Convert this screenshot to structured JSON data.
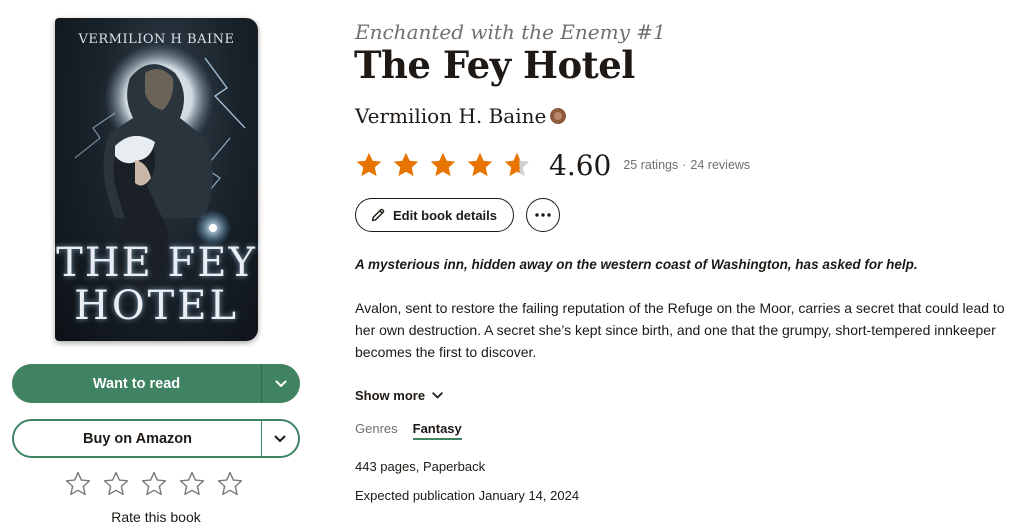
{
  "book": {
    "series": "Enchanted with the Enemy #1",
    "title": "The Fey Hotel",
    "author": "Vermilion H. Baine",
    "cover": {
      "author_text": "VERMILION H BAINE",
      "title_line1": "THE FEY",
      "title_line2": "HOTEL"
    }
  },
  "rating": {
    "average": "4.60",
    "stars_value": 4.6,
    "ratings_count": "25 ratings",
    "separator": "·",
    "reviews_count": "24 reviews",
    "star_color": "#e87400",
    "star_empty_color": "#cfcfcf"
  },
  "actions": {
    "edit_label": "Edit book details",
    "more_icon": "ellipsis-icon"
  },
  "shelf": {
    "want_to_read_label": "Want to read",
    "buy_label": "Buy on Amazon",
    "rate_label": "Rate this book",
    "accent_color": "#3f8363"
  },
  "description": {
    "tagline": "A mysterious inn, hidden away on the western coast of Washington, has asked for help.",
    "body": "Avalon, sent to restore the failing reputation of the Refuge on the Moor, carries a secret that could lead to her own destruction. A secret she’s kept since birth, and one that the grumpy, short-tempered innkeeper becomes the first to discover.",
    "show_more_label": "Show more"
  },
  "genres": {
    "label": "Genres",
    "items": [
      "Fantasy"
    ]
  },
  "details": {
    "format": "443 pages, Paperback",
    "publication": "Expected publication January 14, 2024"
  }
}
